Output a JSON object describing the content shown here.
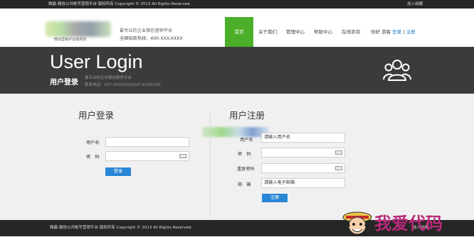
{
  "topbar": {
    "copyright": "微赢-微信公共帐号营销平台 版权所有 Copyright © 2013 All Rights Reserved.",
    "favorite": "加入收藏"
  },
  "header": {
    "logo_sub": "微信营销平台提供商",
    "tagline": "最专业的企业微信营销平台",
    "hotline": "全国招商热线：400-XXX-XXXX",
    "nav": [
      "首页",
      "关于我们",
      "管理中心",
      "帮助中心",
      "在线咨询"
    ],
    "greeting": "你好",
    "guest": "游客",
    "login": "登录",
    "separator": "|",
    "register": "注册"
  },
  "banner": {
    "title": "User Login",
    "subtitle": "用户登录",
    "meta1": "最专业的企业微信服务平台",
    "meta2": "联系电话：027-XXXXXXX/027-XXXXXXX",
    "icon": "users-icon"
  },
  "login": {
    "heading": "用户登录",
    "username_label": "用户名",
    "password_label": "密　码",
    "username_value": "",
    "password_value": "",
    "submit": "登录"
  },
  "register": {
    "heading": "用户注册",
    "username_label": "用户名",
    "username_placeholder": "请输入用户名",
    "password_label": "密　码",
    "confirm_label": "重复密码",
    "email_label": "邮　箱",
    "email_placeholder": "请输入电子邮箱",
    "submit": "注册"
  },
  "footer": {
    "copyright": "微赢-微信公共帐号营销平台 版权所有 Copyright © 2013 All Rights Reserved.",
    "favorite": "加入收藏"
  },
  "watermark": {
    "text": "我爱代码"
  },
  "colors": {
    "nav_active": "#4caf29",
    "button": "#2a86d6",
    "banner": "#3b3b3b",
    "bar": "#262626"
  }
}
